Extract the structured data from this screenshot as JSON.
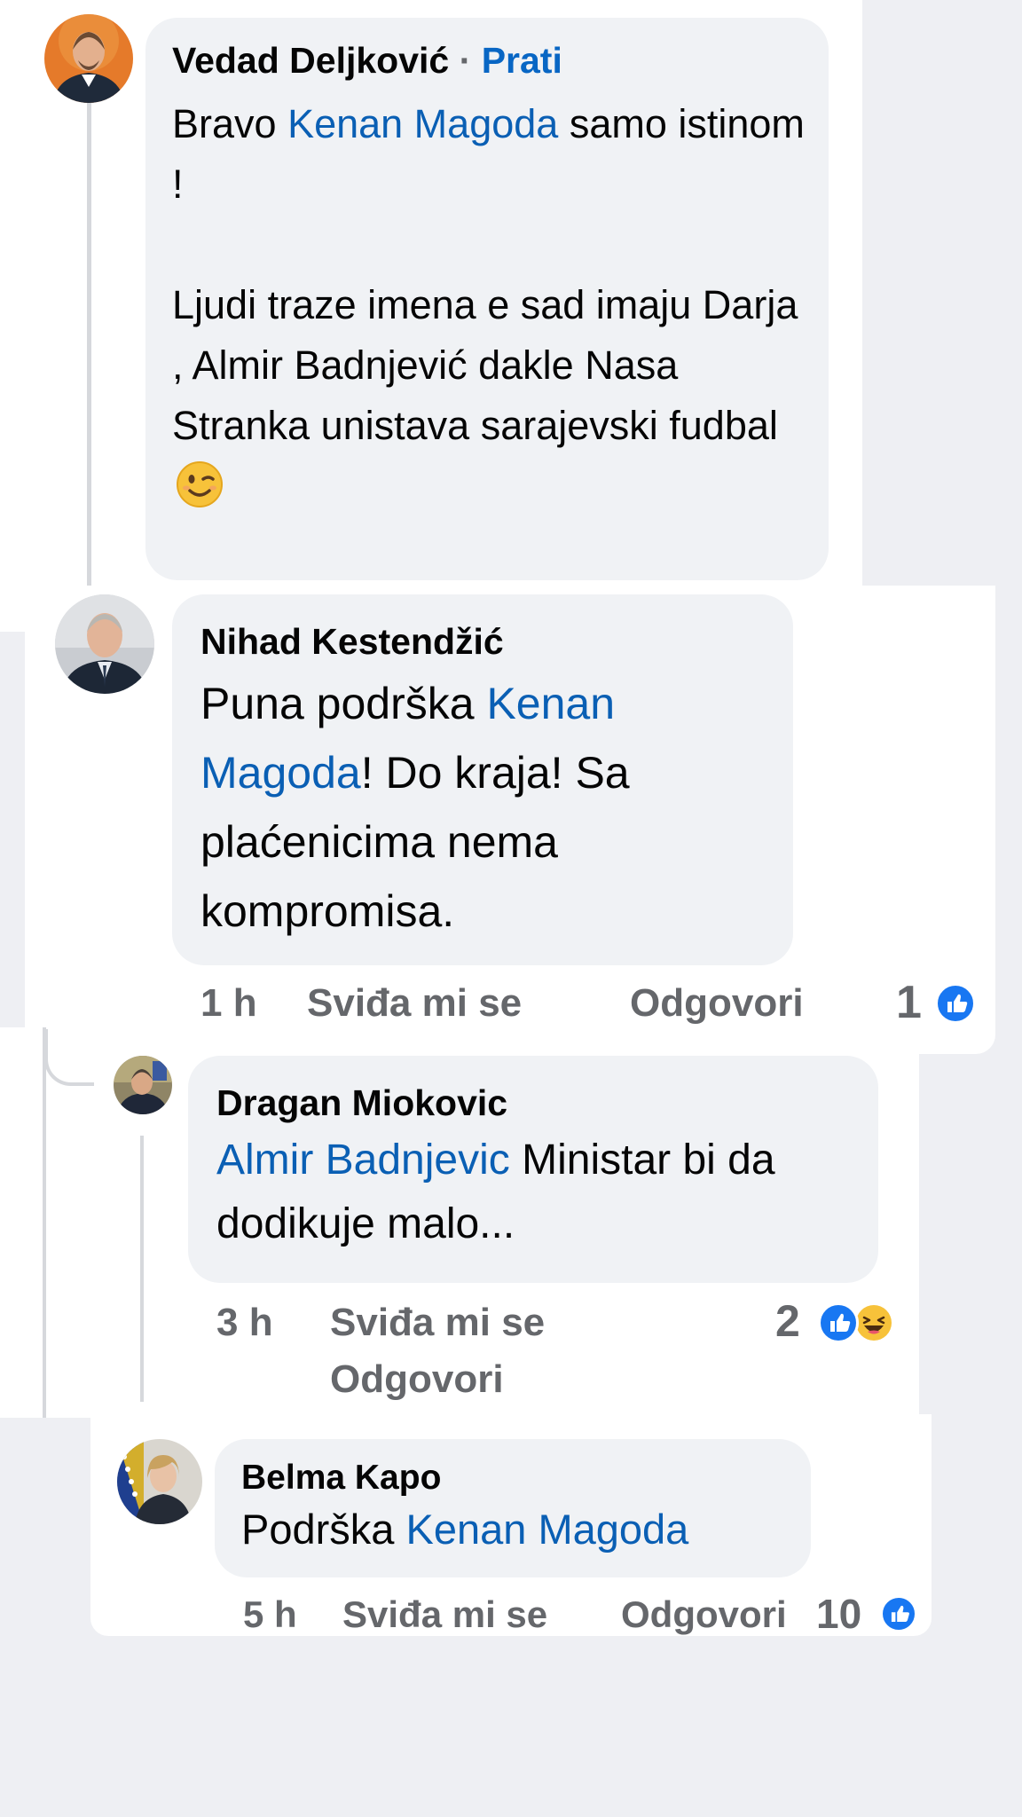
{
  "comments": [
    {
      "author": "Vedad Deljković",
      "separator": "·",
      "follow_label": "Prati",
      "text_parts": [
        "Bravo ",
        "Kenan Magoda",
        " samo istinom !"
      ],
      "text_line2": "Ljudi traze imena e sad imaju Darja , Almir Badnjević dakle Nasa Stranka unistava sarajevski fudbal",
      "emoji": "winking-face"
    },
    {
      "author": "Nihad Kestendžić",
      "text_parts": [
        "Puna podrška ",
        "Kenan Magoda",
        "! Do kraja! Sa plaćenicima nema kompromisa."
      ],
      "time": "1 h",
      "like_label": "Sviđa mi se",
      "reply_label": "Odgovori",
      "reaction_count": "1",
      "reactions": [
        "like-icon"
      ]
    },
    {
      "author": "Dragan Miokovic",
      "text_parts": [
        "Almir Badnjevic",
        " Ministar bi da dodikuje malo..."
      ],
      "time": "3 h",
      "like_label": "Sviđa mi se",
      "reply_label": "Odgovori",
      "reaction_count": "2",
      "reactions": [
        "like-icon",
        "haha-icon"
      ]
    },
    {
      "author": "Belma Kapo",
      "text_parts": [
        "Podrška ",
        "Kenan Magoda"
      ],
      "time": "5 h",
      "like_label": "Sviđa mi se",
      "reply_label": "Odgovori",
      "reaction_count": "10",
      "reactions": [
        "like-icon"
      ]
    }
  ],
  "colors": {
    "mention": "#0a5fb4",
    "meta": "#65676b",
    "bubble": "#f0f2f5",
    "like": "#1877f2",
    "background": "#eeeff3"
  }
}
